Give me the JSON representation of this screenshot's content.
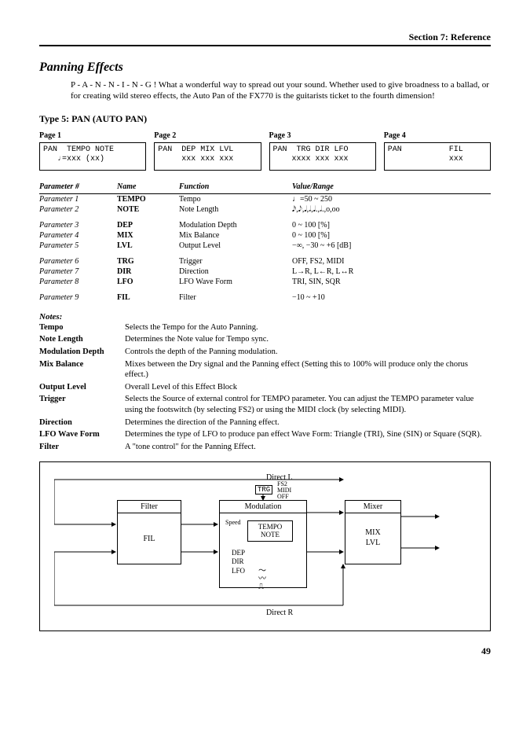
{
  "section_header": "Section 7: Reference",
  "title": "Panning Effects",
  "intro": "P - A - N - N - I - N - G !  What a wonderful way to spread out your sound.  Whether used to give broadness to a ballad, or for creating wild stereo effects, the Auto Pan of the FX770 is the guitarists ticket to the fourth dimension!",
  "type_heading": "Type 5: PAN (AUTO PAN)",
  "pages": [
    {
      "label": "Page 1",
      "line1": "PAN  TEMPO NOTE",
      "line2": "   ♩=xxx (xx)"
    },
    {
      "label": "Page 2",
      "line1": "PAN  DEP MIX LVL",
      "line2": "     xxx xxx xxx"
    },
    {
      "label": "Page 3",
      "line1": "PAN  TRG DIR LFO",
      "line2": "    xxxx xxx xxx"
    },
    {
      "label": "Page 4",
      "line1": "PAN          FIL",
      "line2": "             xxx"
    }
  ],
  "param_headers": {
    "pn": "Parameter #",
    "nm": "Name",
    "fn": "Function",
    "vr": "Value/Range"
  },
  "params": [
    {
      "pn": "Parameter 1",
      "nm": "TEMPO",
      "fn": "Tempo",
      "vr": "♩=50 ~ 250"
    },
    {
      "pn": "Parameter 2",
      "nm": "NOTE",
      "fn": "Note Length",
      "vr": "𝅘𝅥𝅯,𝅘𝅥𝅮,𝅘𝅥,𝅗𝅥,𝅘𝅥.,𝅗𝅥.,o,oo"
    },
    {
      "pn": "Parameter 3",
      "nm": "DEP",
      "fn": "Modulation Depth",
      "vr": "0 ~ 100 [%]",
      "gap": true
    },
    {
      "pn": "Parameter 4",
      "nm": "MIX",
      "fn": "Mix Balance",
      "vr": "0 ~ 100 [%]"
    },
    {
      "pn": "Parameter 5",
      "nm": "LVL",
      "fn": "Output Level",
      "vr": "−∞, −30 ~ +6 [dB]"
    },
    {
      "pn": "Parameter 6",
      "nm": "TRG",
      "fn": "Trigger",
      "vr": "OFF, FS2, MIDI",
      "gap": true
    },
    {
      "pn": "Parameter 7",
      "nm": "DIR",
      "fn": "Direction",
      "vr": "L→R, L←R, L↔R"
    },
    {
      "pn": "Parameter 8",
      "nm": "LFO",
      "fn": "LFO Wave Form",
      "vr": "TRI, SIN, SQR"
    },
    {
      "pn": "Parameter 9",
      "nm": "FIL",
      "fn": "Filter",
      "vr": "−10 ~ +10",
      "gap": true
    }
  ],
  "notes_heading": "Notes:",
  "notes": [
    {
      "k": "Tempo",
      "v": "Selects the Tempo for the Auto Panning."
    },
    {
      "k": "Note Length",
      "v": "Determines the Note value for Tempo sync."
    },
    {
      "k": "Modulation Depth",
      "v": "Controls the depth of the Panning modulation.",
      "gap": true
    },
    {
      "k": "Mix Balance",
      "v": "Mixes between the Dry signal and the Panning effect (Setting this to 100% will produce only the chorus effect.)"
    },
    {
      "k": "Output Level",
      "v": "Overall Level of this Effect Block"
    },
    {
      "k": "Trigger",
      "v": "Selects the Source of external control for TEMPO parameter. You can adjust the TEMPO parameter value using the footswitch (by selecting FS2) or using the MIDI clock (by selecting MIDI).",
      "gap": true
    },
    {
      "k": "Direction",
      "v": "Determines the direction of the Panning effect."
    },
    {
      "k": "LFO Wave Form",
      "v": "Determines the type of LFO to produce pan effect Wave Form: Triangle (TRI), Sine (SIN) or Square (SQR)."
    },
    {
      "k": "Filter",
      "v": "A \"tone control\" for the Panning Effect.",
      "gap": true
    }
  ],
  "diagram": {
    "direct_l": "Direct L",
    "direct_r": "Direct R",
    "filter_hdr": "Filter",
    "filter_body": "FIL",
    "mod_hdr": "Modulation",
    "mod_speed": "Speed",
    "mod_tempo": "TEMPO",
    "mod_note": "NOTE",
    "mod_dep": "DEP",
    "mod_dir": "DIR",
    "mod_lfo": "LFO",
    "mixer_hdr": "Mixer",
    "mixer_mix": "MIX",
    "mixer_lvl": "LVL",
    "trg": "TRG",
    "trg_fs2": "FS2",
    "trg_midi": "MIDI",
    "trg_off": "OFF"
  },
  "page_num": "49"
}
